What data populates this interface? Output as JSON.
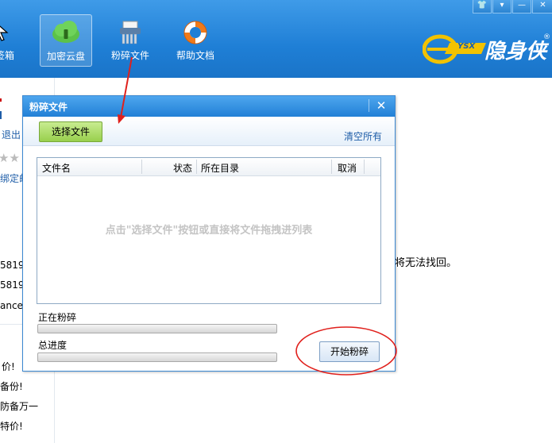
{
  "toolbar": {
    "items": [
      {
        "label": "签箱"
      },
      {
        "label": "加密云盘"
      },
      {
        "label": "粉碎文件"
      },
      {
        "label": "帮助文档"
      }
    ]
  },
  "window_controls": {
    "skin": "👕",
    "menu": "▾",
    "minimize": "—",
    "close": "✕"
  },
  "logo": {
    "brand_text": "隐身侠",
    "badge": "YSX",
    "registered": "®"
  },
  "left_panel": {
    "lines": [
      "退出",
      "绑定邮",
      "5819",
      "5819",
      "ance",
      "价!",
      "备份!",
      "防备万一",
      "特价!"
    ]
  },
  "main": {
    "text": "将无法找回。"
  },
  "dialog": {
    "title": "粉碎文件",
    "close": "✕",
    "select_button": "选择文件",
    "clear_all": "清空所有",
    "columns": [
      "文件名",
      "状态",
      "所在目录",
      "取消"
    ],
    "empty_hint": "点击\"选择文件\"按钮或直接将文件拖拽进列表",
    "current_label": "正在粉碎",
    "current_progress": 0,
    "total_label": "总进度",
    "total_progress": 0,
    "start_button": "开始粉碎"
  },
  "annotations": {
    "arrow_color": "#e0201c",
    "circle_color": "#e0201c"
  }
}
